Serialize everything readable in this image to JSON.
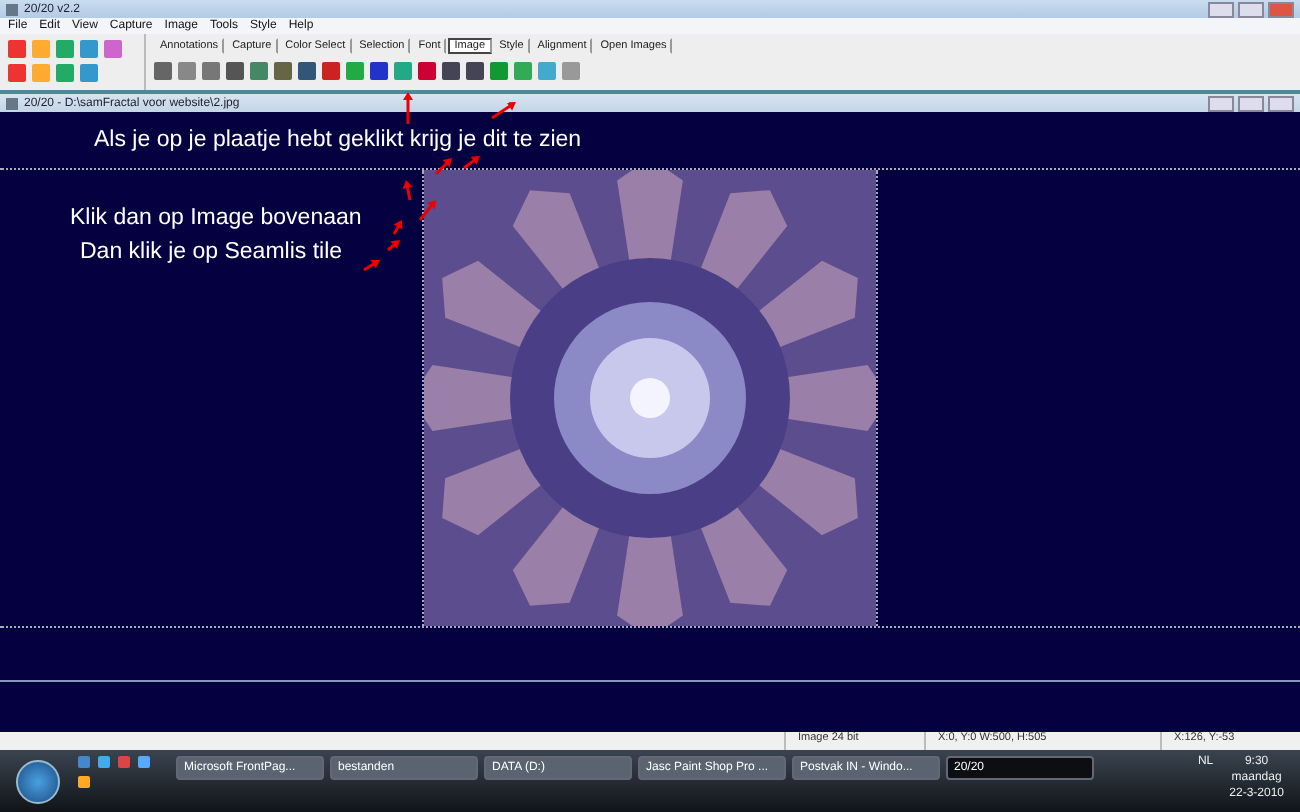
{
  "window": {
    "title": "20/20 v2.2"
  },
  "menu": [
    "File",
    "Edit",
    "View",
    "Capture",
    "Image",
    "Tools",
    "Style",
    "Help"
  ],
  "tabs": [
    {
      "label": "Annotations",
      "selected": false
    },
    {
      "label": "Capture",
      "selected": false
    },
    {
      "label": "Color Select",
      "selected": false
    },
    {
      "label": "Selection",
      "selected": false
    },
    {
      "label": "Font",
      "selected": false
    },
    {
      "label": "Image",
      "selected": true
    },
    {
      "label": "Style",
      "selected": false
    },
    {
      "label": "Alignment",
      "selected": false
    },
    {
      "label": "Open Images",
      "selected": false
    }
  ],
  "document": {
    "title": "20/20 - D:\\samFractal voor website\\2.jpg",
    "notes": [
      "Als je op je plaatje hebt geklikt krijg je dit te zien",
      "Klik dan op Image bovenaan",
      "Dan klik je op Seamlis tile"
    ]
  },
  "status_bar": [
    "Image 24 bit",
    "X:0, Y:0 W:500, H:505",
    "X:126, Y:-53"
  ],
  "taskbar": {
    "buttons": [
      {
        "label": "Microsoft FrontPag...",
        "selected": false
      },
      {
        "label": "bestanden",
        "selected": false
      },
      {
        "label": "DATA (D:)",
        "selected": false
      },
      {
        "label": "Jasc Paint Shop Pro ...",
        "selected": false
      },
      {
        "label": "Postvak IN - Windo...",
        "selected": false
      },
      {
        "label": "20/20",
        "selected": true
      }
    ],
    "language": "NL",
    "time": "9:30",
    "day": "maandag",
    "date": "22-3-2010"
  }
}
